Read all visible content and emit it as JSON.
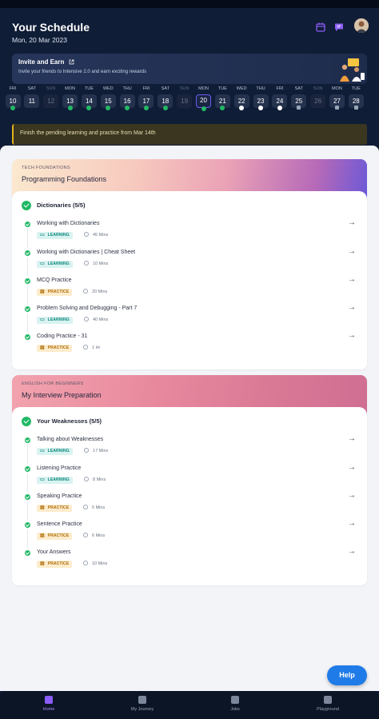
{
  "header": {
    "title": "Your Schedule",
    "date": "Mon, 20 Mar 2023"
  },
  "invite": {
    "title": "Invite and Earn",
    "subtitle": "Invite your friends to Intensive 2.0 and earn exciting rewards"
  },
  "calendar": [
    {
      "name": "FRI",
      "num": "10",
      "state": "partial"
    },
    {
      "name": "SAT",
      "num": "11",
      "state": "normal"
    },
    {
      "name": "SUN",
      "num": "12",
      "state": "dim"
    },
    {
      "name": "MON",
      "num": "13",
      "state": "done"
    },
    {
      "name": "TUE",
      "num": "14",
      "state": "done"
    },
    {
      "name": "WED",
      "num": "15",
      "state": "done"
    },
    {
      "name": "THU",
      "num": "16",
      "state": "done"
    },
    {
      "name": "FRI",
      "num": "17",
      "state": "done"
    },
    {
      "name": "SAT",
      "num": "18",
      "state": "done"
    },
    {
      "name": "SUN",
      "num": "19",
      "state": "dim"
    },
    {
      "name": "MON",
      "num": "20",
      "state": "selected"
    },
    {
      "name": "TUE",
      "num": "21",
      "state": "done"
    },
    {
      "name": "WED",
      "num": "22",
      "state": "pending"
    },
    {
      "name": "THU",
      "num": "23",
      "state": "pending"
    },
    {
      "name": "FRI",
      "num": "24",
      "state": "pending"
    },
    {
      "name": "SAT",
      "num": "25",
      "state": "locked"
    },
    {
      "name": "SUN",
      "num": "26",
      "state": "dim"
    },
    {
      "name": "MON",
      "num": "27",
      "state": "locked"
    },
    {
      "name": "TUE",
      "num": "28",
      "state": "locked"
    }
  ],
  "notice": "Finish the pending learning and practice from Mar 14th",
  "cards": [
    {
      "kicker": "TECH FOUNDATIONS",
      "title": "Programming Foundations",
      "section": "Dictionaries (5/5)",
      "items": [
        {
          "name": "Working with Dictionaries",
          "tag": "LEARNING",
          "type": "learn",
          "duration": "45 Mins"
        },
        {
          "name": "Working with Dictionaries | Cheat Sheet",
          "tag": "LEARNING",
          "type": "learn",
          "duration": "10 Mins"
        },
        {
          "name": "MCQ Practice",
          "tag": "PRACTICE",
          "type": "prac",
          "duration": "20 Mins"
        },
        {
          "name": "Problem Solving and Debugging - Part 7",
          "tag": "LEARNING",
          "type": "learn",
          "duration": "40 Mins"
        },
        {
          "name": "Coding Practice - 31",
          "tag": "PRACTICE",
          "type": "prac",
          "duration": "1 Hr"
        }
      ]
    },
    {
      "kicker": "ENGLISH FOR BEGINNERS",
      "title": "My Interview Preparation",
      "section": "Your Weaknesses (5/5)",
      "items": [
        {
          "name": "Talking about Weaknesses",
          "tag": "LEARNING",
          "type": "learn",
          "duration": "17 Mins"
        },
        {
          "name": "Listening Practice",
          "tag": "LEARNING",
          "type": "learn",
          "duration": "8 Mins"
        },
        {
          "name": "Speaking Practice",
          "tag": "PRACTICE",
          "type": "prac",
          "duration": "5 Mins"
        },
        {
          "name": "Sentence Practice",
          "tag": "PRACTICE",
          "type": "prac",
          "duration": "6 Mins"
        },
        {
          "name": "Your Answers",
          "tag": "PRACTICE",
          "type": "prac",
          "duration": "10 Mins"
        }
      ]
    }
  ],
  "help": "Help",
  "nav": [
    {
      "label": "Home",
      "icon": "home-icon",
      "active": true
    },
    {
      "label": "My Journey",
      "icon": "journey-icon",
      "active": false
    },
    {
      "label": "Jobs",
      "icon": "jobs-icon",
      "active": false
    },
    {
      "label": "Playground",
      "icon": "terminal-icon",
      "active": false
    }
  ],
  "colors": {
    "accent": "#6b5cf0",
    "success": "#22b865",
    "help": "#1f7be8",
    "notice": "#e3b21a"
  }
}
